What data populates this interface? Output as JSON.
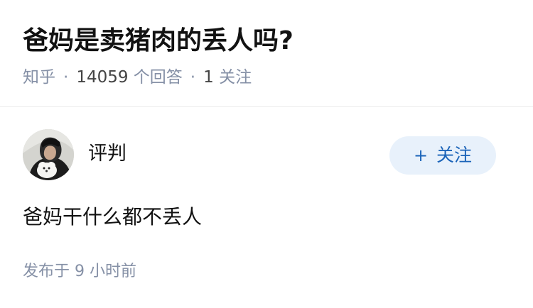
{
  "question": {
    "title": "爸妈是卖猪肉的丢人吗?",
    "meta": {
      "source": "知乎",
      "separator": "·",
      "answer_count": "14059",
      "answer_suffix": "个回答",
      "follow_count": "1",
      "follow_suffix": "关注"
    }
  },
  "answer": {
    "author": {
      "name": "评判",
      "avatar_icon": "avatar-person-with-dog-icon"
    },
    "follow_button": {
      "plus": "+",
      "label": "关注"
    },
    "content": "爸妈干什么都不丢人",
    "publish_time": "发布于 9 小时前"
  },
  "colors": {
    "title": "#121212",
    "meta": "#8590a6",
    "follow_button_bg": "#e8f1fb",
    "follow_button_text": "#1b64b9",
    "divider": "#ebebeb"
  }
}
